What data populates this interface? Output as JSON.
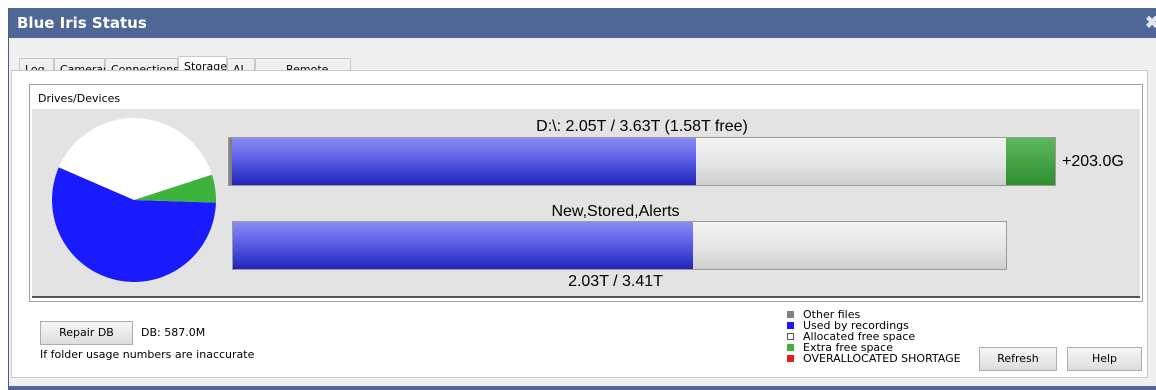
{
  "window": {
    "title": "Blue Iris Status",
    "close_glyph": "✖"
  },
  "tabs": [
    {
      "label": "Log",
      "active": false
    },
    {
      "label": "Cameras",
      "active": false
    },
    {
      "label": "Connections",
      "active": false
    },
    {
      "label": "Storage",
      "active": true
    },
    {
      "label": "AI",
      "active": false
    },
    {
      "label": "Remote",
      "active": false
    }
  ],
  "storage": {
    "group_label": "Drives/Devices",
    "drive_bar": {
      "label": "D:\\: 2.05T / 3.63T (1.58T free)",
      "used_fraction": 0.565,
      "other_fraction": 0.004,
      "extra_label": "+203.0G"
    },
    "folder_bar": {
      "label": "New,Stored,Alerts",
      "value_label": "2.03T / 3.41T",
      "used_fraction": 0.595
    },
    "pie": {
      "used_fraction": 0.56,
      "extra_fraction": 0.055,
      "free_fraction": 0.385
    }
  },
  "footer": {
    "repair_label": "Repair DB",
    "db_size": "DB: 587.0M",
    "hint": "If folder usage numbers are inaccurate",
    "refresh_label": "Refresh",
    "help_label": "Help"
  },
  "legend": [
    {
      "label": "Other files",
      "color": "#808080"
    },
    {
      "label": "Used by recordings",
      "color": "#1a1aff"
    },
    {
      "label": "Allocated free space",
      "color": "#ffffff"
    },
    {
      "label": "Extra free space",
      "color": "#3cb43c"
    },
    {
      "label": "OVERALLOCATED SHORTAGE",
      "color": "#e02020"
    }
  ],
  "colors": {
    "titlebar": "#4e6797",
    "used": "#1a1aff",
    "free": "#ffffff",
    "extra": "#3cb43c"
  }
}
